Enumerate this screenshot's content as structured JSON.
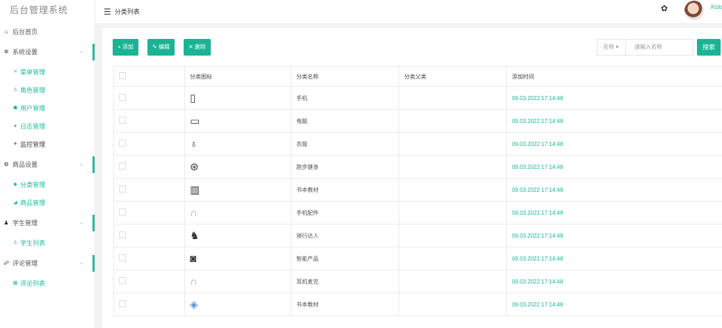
{
  "app": {
    "title": "后台管理系统",
    "breadcrumb": "分类列表",
    "user_name": "Kob"
  },
  "sidebar": {
    "home": {
      "label": "后台首页",
      "icon": "home-icon"
    },
    "groups": [
      {
        "label": "系统设置",
        "icon": "gear-icon",
        "children": [
          {
            "label": "菜单管理",
            "icon": "list-icon",
            "active": true
          },
          {
            "label": "角色管理",
            "icon": "user-role-icon",
            "active": true
          },
          {
            "label": "用户管理",
            "icon": "users-icon",
            "active": true
          },
          {
            "label": "日志管理",
            "icon": "log-icon",
            "active": true
          },
          {
            "label": "监控管理",
            "icon": "monitor-icon",
            "active": false
          }
        ]
      },
      {
        "label": "商品设置",
        "icon": "shop-icon",
        "children": [
          {
            "label": "分类管理",
            "icon": "category-icon",
            "active": true
          },
          {
            "label": "商品管理",
            "icon": "goods-icon",
            "active": true
          }
        ]
      },
      {
        "label": "学生管理",
        "icon": "student-icon",
        "children": [
          {
            "label": "学生列表",
            "icon": "student-list-icon",
            "active": true
          }
        ]
      },
      {
        "label": "评论管理",
        "icon": "comment-icon",
        "children": [
          {
            "label": "评论列表",
            "icon": "comment-list-icon",
            "active": true
          }
        ]
      }
    ]
  },
  "toolbar": {
    "add_label": "+ 添加",
    "edit_label": "✎ 编辑",
    "delete_label": "✕ 删除",
    "search_select_label": "名称 ▾",
    "search_placeholder": "请输入名称",
    "search_button_label": "搜索"
  },
  "table": {
    "columns": [
      "分类图标",
      "分类名称",
      "分类父类",
      "添加时间"
    ],
    "rows": [
      {
        "icon": "phone-icon",
        "name": "手机",
        "parent": "",
        "time": "09.03.2022 17:14:48"
      },
      {
        "icon": "computer-icon",
        "name": "电脑",
        "parent": "",
        "time": "09.03.2022 17:14:48"
      },
      {
        "icon": "clothes-icon",
        "name": "衣服",
        "parent": "",
        "time": "09.03.2022 17:14:48"
      },
      {
        "icon": "basketball-icon",
        "name": "跑步健身",
        "parent": "",
        "time": "09.03.2022 17:14:48"
      },
      {
        "icon": "books-icon",
        "name": "书本教材",
        "parent": "",
        "time": "09.03.2022 17:14:48"
      },
      {
        "icon": "headphones-icon",
        "name": "手机配件",
        "parent": "",
        "time": "09.03.2022 17:14:48"
      },
      {
        "icon": "cyclist-icon",
        "name": "骑行达人",
        "parent": "",
        "time": "09.03.2022 17:14:48"
      },
      {
        "icon": "camera-icon",
        "name": "智能产品",
        "parent": "",
        "time": "09.03.2022 17:14:48"
      },
      {
        "icon": "headphones-icon",
        "name": "耳机麦克",
        "parent": "",
        "time": "09.03.2022 17:14:48"
      },
      {
        "icon": "book-icon",
        "name": "书本教材",
        "parent": "",
        "time": "09.03.2022 17:14:48"
      }
    ]
  },
  "colors": {
    "accent": "#1ab394",
    "background": "#f3f3f4"
  }
}
